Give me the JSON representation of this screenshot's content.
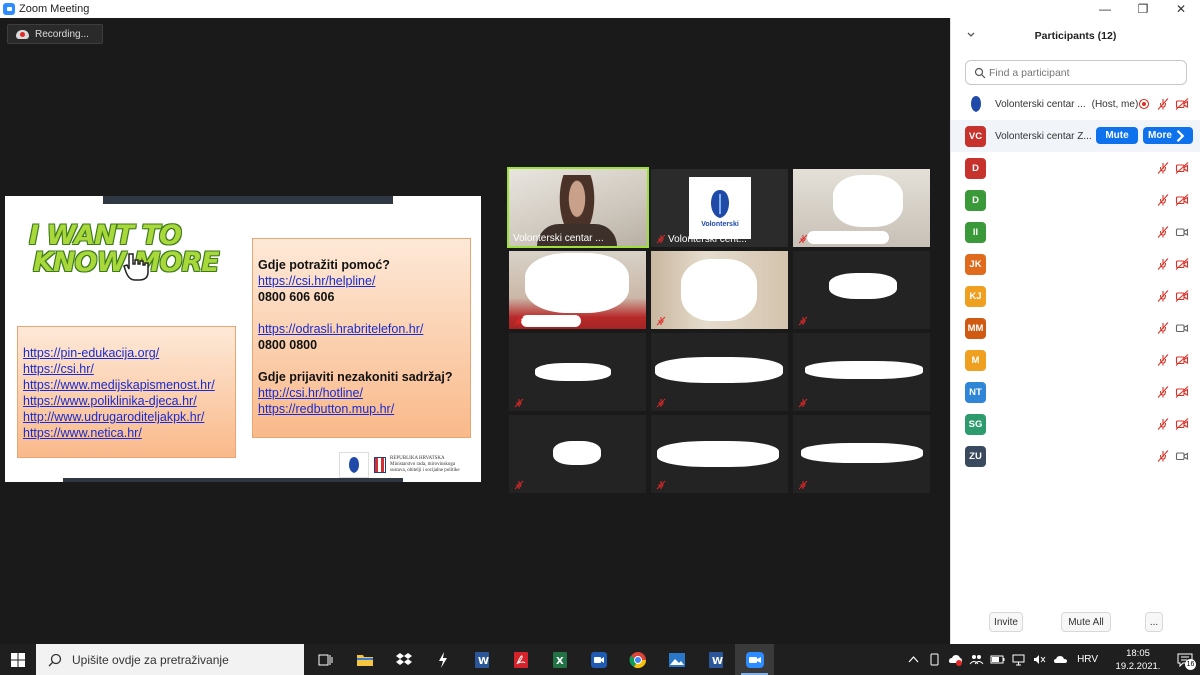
{
  "window": {
    "title": "Zoom Meeting"
  },
  "recording": {
    "label": "Recording..."
  },
  "slide": {
    "headline_line1": "I WANT TO",
    "headline_line2": "KNOW MORE",
    "links": [
      "https://pin-edukacija.org/",
      "https://csi.hr/",
      "https://www.medijskapismenost.hr/",
      "https://www.poliklinika-djeca.hr/",
      "http://www.udrugaroditeljakpk.hr/",
      "https://www.netica.hr/"
    ],
    "help_heading": "Gdje potražiti pomoć?",
    "help_link_1": "https://csi.hr/helpline/",
    "help_phone_1": "0800 606 606",
    "help_link_2": "https://odrasli.hrabritelefon.hr/",
    "help_phone_2": "0800 0800",
    "report_heading": "Gdje prijaviti nezakoniti sadržaj?",
    "report_link_1": "http://csi.hr/hotline/",
    "report_link_2": "https://redbutton.mup.hr/",
    "ministry_line1": "REPUBLIKA HRVATSKA",
    "ministry_line2": "Ministarstvo rada, mirovinskoga",
    "ministry_line3": "sustava, obitelji i socijalne politike"
  },
  "videos": [
    {
      "name": "Volonterski centar ..."
    },
    {
      "name": "Volonterski cent...",
      "logo_text": "Volonterski"
    }
  ],
  "participants": {
    "title": "Participants (12)",
    "search_placeholder": "Find a participant",
    "list": [
      {
        "initials": "",
        "name": "Volonterski centar ...",
        "tag": "(Host, me)",
        "color": "#ffffff",
        "video": "off"
      },
      {
        "initials": "VC",
        "name": "Volonterski centar Z...",
        "color": "#c7322c",
        "video": "off"
      },
      {
        "initials": "D",
        "color": "#c7322c",
        "video": "off"
      },
      {
        "initials": "D",
        "color": "#3a9a3a",
        "video": "off"
      },
      {
        "initials": "II",
        "color": "#3a9a3a",
        "video": "on"
      },
      {
        "initials": "JK",
        "color": "#e06b1d",
        "video": "off"
      },
      {
        "initials": "KJ",
        "color": "#f0a020",
        "video": "off"
      },
      {
        "initials": "MM",
        "color": "#d05a12",
        "video": "on"
      },
      {
        "initials": "M",
        "color": "#f0a020",
        "video": "off"
      },
      {
        "initials": "NT",
        "color": "#2f86d6",
        "video": "off"
      },
      {
        "initials": "SG",
        "color": "#2e9b6f",
        "video": "off"
      },
      {
        "initials": "ZU",
        "color": "#3a4a5e",
        "video": "on"
      }
    ],
    "mute_label": "Mute",
    "more_label": "More",
    "invite_label": "Invite",
    "mute_all_label": "Mute All",
    "overflow_label": "..."
  },
  "taskbar": {
    "search_placeholder": "Upišite ovdje za pretraživanje",
    "language": "HRV",
    "time": "18:05",
    "date": "19.2.2021.",
    "notifications": "16"
  }
}
